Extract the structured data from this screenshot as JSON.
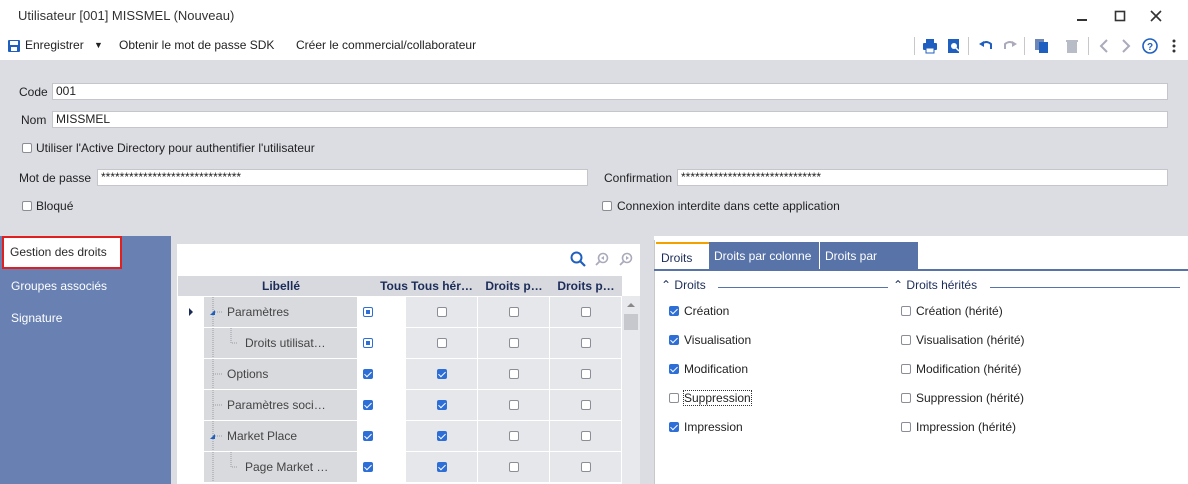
{
  "window": {
    "title": "Utilisateur [001] MISSMEL (Nouveau)"
  },
  "toolbar": {
    "save_label": "Enregistrer",
    "sdk_label": "Obtenir le mot de passe SDK",
    "commercial_label": "Créer le commercial/collaborateur"
  },
  "form": {
    "code_label": "Code",
    "code_value": "001",
    "nom_label": "Nom",
    "nom_value": "MISSMEL",
    "ad_label": "Utiliser l'Active Directory pour authentifier l'utilisateur",
    "password_label": "Mot de passe",
    "password_value": "******************************",
    "confirmation_label": "Confirmation",
    "confirmation_value": "******************************",
    "blocked_label": "Bloqué",
    "connexion_label": "Connexion interdite dans cette application"
  },
  "nav": {
    "items": [
      {
        "label": "Gestion des droits"
      },
      {
        "label": "Groupes associés"
      },
      {
        "label": "Signature"
      }
    ]
  },
  "grid": {
    "headers": [
      "Libellé",
      "Tous",
      "Tous hér…",
      "Droits p…",
      "Droits p…"
    ],
    "rows": [
      {
        "label": "Paramètres",
        "tous": "partial",
        "tous_herites": false,
        "droits_p1": false,
        "droits_p2": false
      },
      {
        "label": "Droits utilisat…",
        "tous": "partial",
        "tous_herites": false,
        "droits_p1": false,
        "droits_p2": false
      },
      {
        "label": "Options",
        "tous": true,
        "tous_herites": true,
        "droits_p1": false,
        "droits_p2": false
      },
      {
        "label": "Paramètres soci…",
        "tous": true,
        "tous_herites": true,
        "droits_p1": false,
        "droits_p2": false
      },
      {
        "label": "Market Place",
        "tous": true,
        "tous_herites": true,
        "droits_p1": false,
        "droits_p2": false
      },
      {
        "label": "Page Market …",
        "tous": true,
        "tous_herites": true,
        "droits_p1": false,
        "droits_p2": false
      }
    ]
  },
  "rights": {
    "tabs": [
      "Droits",
      "Droits par colonne",
      "Droits par valeur"
    ],
    "group_droits": "Droits",
    "group_herites": "Droits hérités",
    "droits": [
      {
        "label": "Création",
        "checked": true
      },
      {
        "label": "Visualisation",
        "checked": true
      },
      {
        "label": "Modification",
        "checked": true
      },
      {
        "label": "Suppression",
        "checked": false
      },
      {
        "label": "Impression",
        "checked": true
      }
    ],
    "herites": [
      {
        "label": "Création (hérité)",
        "checked": false
      },
      {
        "label": "Visualisation (hérité)",
        "checked": false
      },
      {
        "label": "Modification (hérité)",
        "checked": false
      },
      {
        "label": "Suppression (hérité)",
        "checked": false
      },
      {
        "label": "Impression (hérité)",
        "checked": false
      }
    ]
  },
  "colors": {
    "accent_blue": "#2d6fd6",
    "nav_bg": "#6880b2",
    "form_bg": "#dcdde3",
    "tab_active_border": "#f4a100",
    "highlight_border": "#e02020"
  }
}
